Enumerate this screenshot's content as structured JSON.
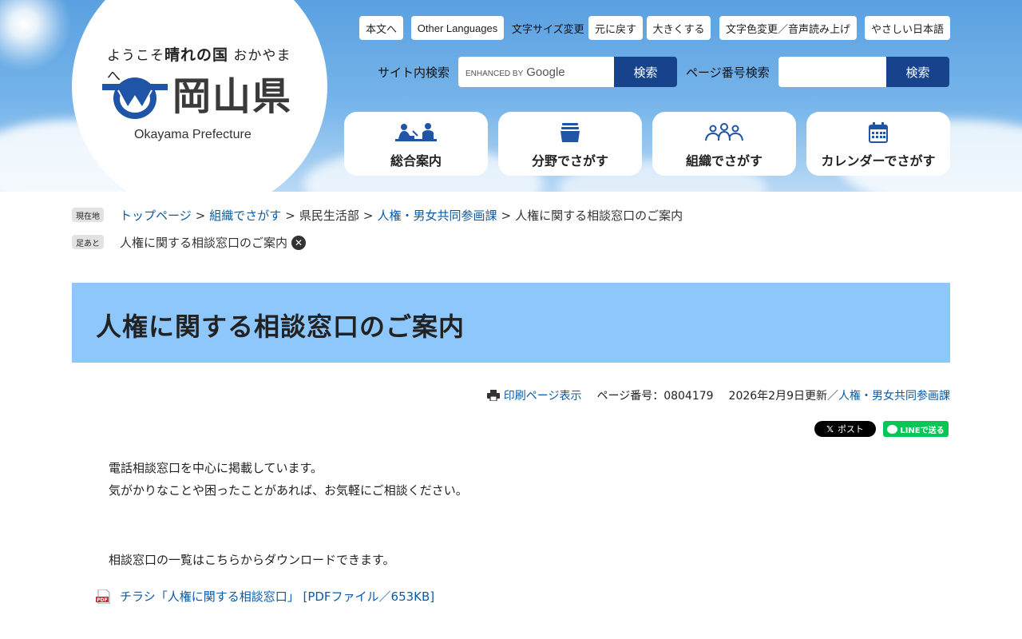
{
  "header": {
    "tagline": {
      "prefix": "ようこそ",
      "emph": "晴れの国",
      "suffix": " おかやまへ"
    },
    "pref_name": "岡山県",
    "pref_name_en": "Okayama Prefecture",
    "utility": {
      "honbun": "本文へ",
      "languages": "Other Languages",
      "font_size_label": "文字サイズ変更",
      "font_reset": "元に戻す",
      "font_larger": "大きくする",
      "color_voice": "文字色変更／音声読み上げ",
      "easy_japanese": "やさしい日本語"
    },
    "site_search": {
      "label": "サイト内検索",
      "brand_small": "ENHANCED BY",
      "brand": "Google",
      "button": "検索"
    },
    "page_search": {
      "label": "ページ番号検索",
      "button": "検索",
      "value": ""
    },
    "nav": [
      {
        "label": "総合案内",
        "icon": "people-desk-icon"
      },
      {
        "label": "分野でさがす",
        "icon": "folder-icon"
      },
      {
        "label": "組織でさがす",
        "icon": "organization-icon"
      },
      {
        "label": "カレンダーでさがす",
        "icon": "calendar-icon"
      }
    ]
  },
  "breadcrumb": {
    "current_tag": "現在地",
    "items": [
      "トップページ",
      "組織でさがす",
      "県民生活部",
      "人権・男女共同参画課",
      "人権に関する相談窓口のご案内"
    ],
    "separator": ">",
    "footmark_tag": "足あと",
    "footmark_item": "人権に関する相談窓口のご案内"
  },
  "page": {
    "title": "人権に関する相談窓口のご案内",
    "print_label": "印刷ページ表示",
    "page_number": "ページ番号：0804179",
    "updated": "2026年2月9日更新／",
    "department": "人権・男女共同参画課",
    "share_x": "ポスト",
    "share_line": "LINEで送る",
    "intro_1": "電話相談窓口を中心に掲載しています。",
    "intro_2": "気がかりなことや困ったことがあれば、お気軽にご相談ください。",
    "download_text": "相談窓口の一覧はこちらからダウンロードできます。",
    "pdf_link": "チラシ「人権に関する相談窓口」 [PDFファイル／653KB]",
    "pdf_badge": "PDF"
  },
  "colors": {
    "header_sky": "#6aaeea",
    "accent_dark_blue": "#16438c",
    "title_band": "#8ec7fb",
    "link": "#0b5aa6",
    "line_green": "#06c755"
  }
}
